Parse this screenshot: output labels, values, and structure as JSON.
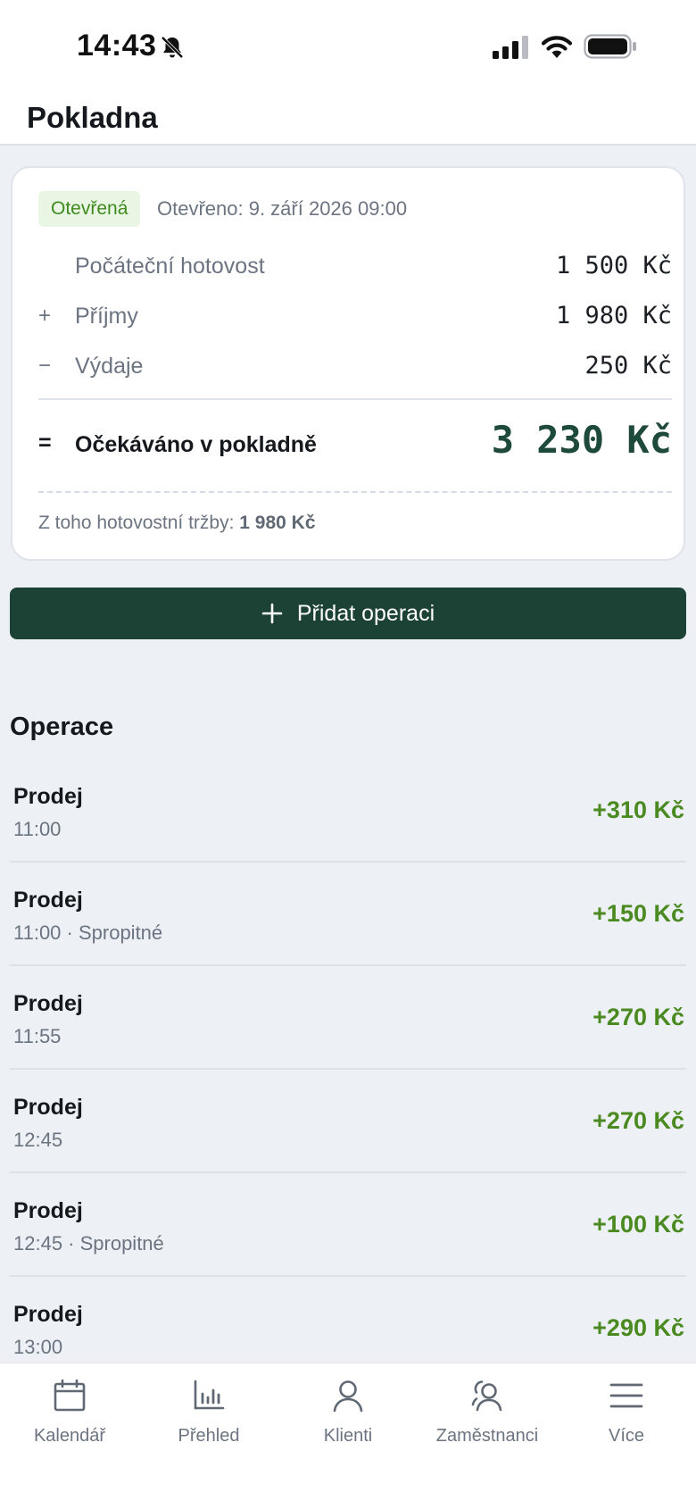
{
  "status_bar": {
    "time": "14:43",
    "icons": [
      "bell-slash-icon",
      "signal-icon",
      "wifi-icon",
      "battery-icon"
    ]
  },
  "header": {
    "title": "Pokladna"
  },
  "summary": {
    "badge": "Otevřená",
    "opened": "Otevřeno: 9. září 2026 09:00",
    "rows": [
      {
        "sign": "",
        "label": "Počáteční hotovost",
        "value": "1 500 Kč"
      },
      {
        "sign": "+",
        "label": "Příjmy",
        "value": "1 980 Kč"
      },
      {
        "sign": "−",
        "label": "Výdaje",
        "value": "250 Kč"
      }
    ],
    "expected": {
      "sign": "=",
      "label": "Očekáváno v pokladně",
      "value": "3 230 Kč"
    },
    "cash_note_prefix": "Z toho hotovostní tržby: ",
    "cash_note_value": "1 980 Kč"
  },
  "actions": {
    "add_label": "Přidat operaci",
    "add_icon": "plus-icon"
  },
  "operations": {
    "title": "Operace",
    "items": [
      {
        "title": "Prodej",
        "meta": "11:00",
        "amount": "+310 Kč"
      },
      {
        "title": "Prodej",
        "meta": "11:00 · Spropitné",
        "amount": "+150 Kč"
      },
      {
        "title": "Prodej",
        "meta": "11:55",
        "amount": "+270 Kč"
      },
      {
        "title": "Prodej",
        "meta": "12:45",
        "amount": "+270 Kč"
      },
      {
        "title": "Prodej",
        "meta": "12:45 · Spropitné",
        "amount": "+100 Kč"
      },
      {
        "title": "Prodej",
        "meta": "13:00",
        "amount": "+290 Kč"
      }
    ]
  },
  "tabbar": {
    "items": [
      {
        "label": "Kalendář",
        "icon": "calendar-icon"
      },
      {
        "label": "Přehled",
        "icon": "bar-chart-icon"
      },
      {
        "label": "Klienti",
        "icon": "user-icon"
      },
      {
        "label": "Zaměstnanci",
        "icon": "users-icon"
      },
      {
        "label": "Více",
        "icon": "menu-icon"
      }
    ]
  },
  "colors": {
    "accent": "#1c4236",
    "positive": "#4a8a20",
    "badge_bg": "#eaf6e4",
    "background": "#edf0f5"
  }
}
